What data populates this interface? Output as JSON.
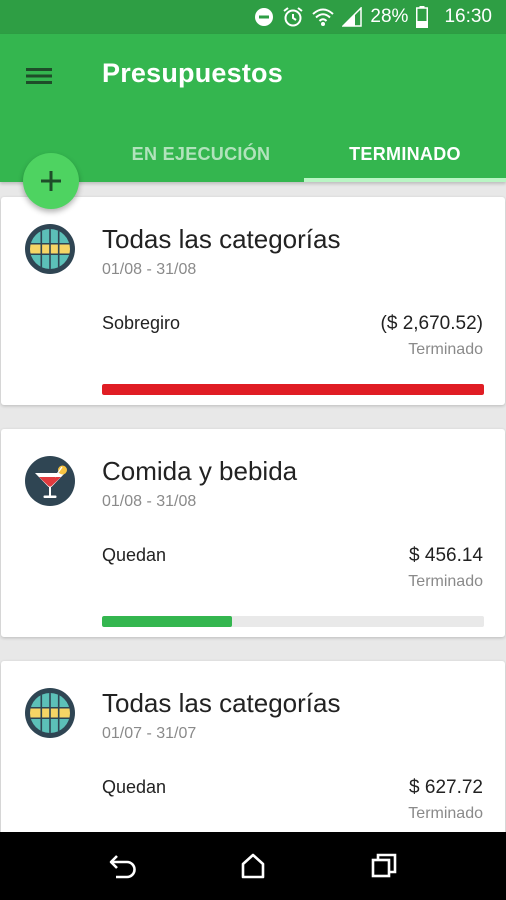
{
  "status_bar": {
    "battery": "28%",
    "time": "16:30"
  },
  "app_bar": {
    "title": "Presupuestos",
    "tabs": [
      {
        "label": "EN EJECUCIÓN"
      },
      {
        "label": "TERMINADO"
      }
    ],
    "active_tab": "TERMINADO"
  },
  "colors": {
    "primary": "#34b64f",
    "primary_dark": "#2e9e44",
    "fab": "#4ed361",
    "overspent": "#e01d24",
    "progress": "#34b64f"
  },
  "budgets": [
    {
      "category": "Todas las categorías",
      "icon": "globe-icon",
      "dates": "01/08 - 31/08",
      "label": "Sobregiro",
      "amount": "($ 2,670.52)",
      "status": "Terminado",
      "progress": 1.0,
      "bar_color": "#e01d24"
    },
    {
      "category": "Comida y bebida",
      "icon": "cocktail-icon",
      "dates": "01/08 - 31/08",
      "label": "Quedan",
      "amount": "$ 456.14",
      "status": "Terminado",
      "progress": 0.34,
      "bar_color": "#34b64f"
    },
    {
      "category": "Todas las categorías",
      "icon": "globe-icon",
      "dates": "01/07 - 31/07",
      "label": "Quedan",
      "amount": "$ 627.72",
      "status": "Terminado",
      "progress": 0.0,
      "bar_color": "#34b64f"
    }
  ]
}
